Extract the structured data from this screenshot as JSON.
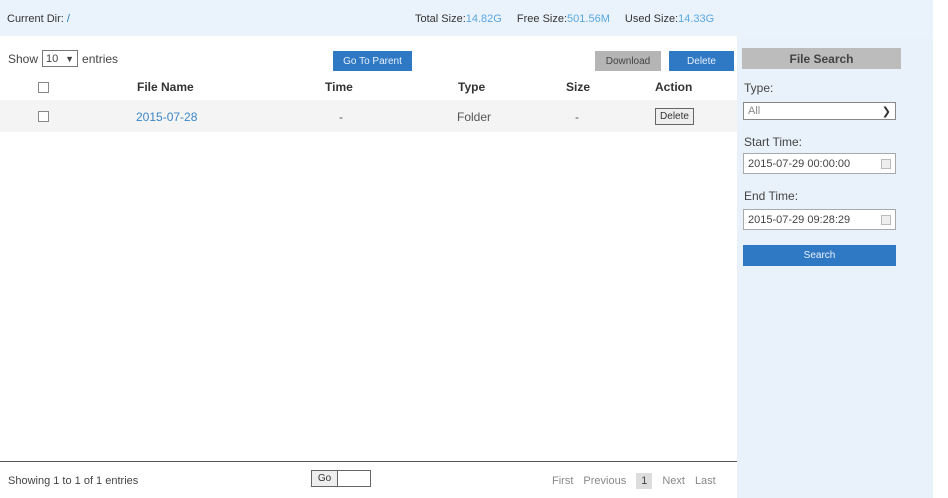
{
  "status": {
    "current_dir_label": "Current Dir:",
    "current_dir_value": "/",
    "total_size_label": "Total Size:",
    "total_size_value": "14.82G",
    "free_size_label": "Free Size:",
    "free_size_value": "501.56M",
    "used_size_label": "Used Size:",
    "used_size_value": "14.33G"
  },
  "toolbar": {
    "show_label": "Show",
    "show_value": "10",
    "entries_label": "entries",
    "go_to_parent": "Go To Parent",
    "download": "Download",
    "delete": "Delete"
  },
  "table": {
    "columns": [
      "File Name",
      "Time",
      "Type",
      "Size",
      "Action"
    ],
    "rows": [
      {
        "file_name": "2015-07-28",
        "time": "-",
        "type": "Folder",
        "size": "-",
        "action": "Delete"
      }
    ]
  },
  "footer": {
    "info": "Showing 1 to 1 of 1 entries",
    "go": "Go",
    "first": "First",
    "previous": "Previous",
    "current_page": "1",
    "next": "Next",
    "last": "Last"
  },
  "search": {
    "title": "File Search",
    "type_label": "Type:",
    "type_value": "All",
    "start_label": "Start Time:",
    "start_value": "2015-07-29 00:00:00",
    "end_label": "End Time:",
    "end_value": "2015-07-29 09:28:29",
    "search_button": "Search"
  },
  "colors": {
    "accent": "#2f78c4",
    "link": "#3a87c8",
    "panel_bg": "#eaf3fb"
  }
}
